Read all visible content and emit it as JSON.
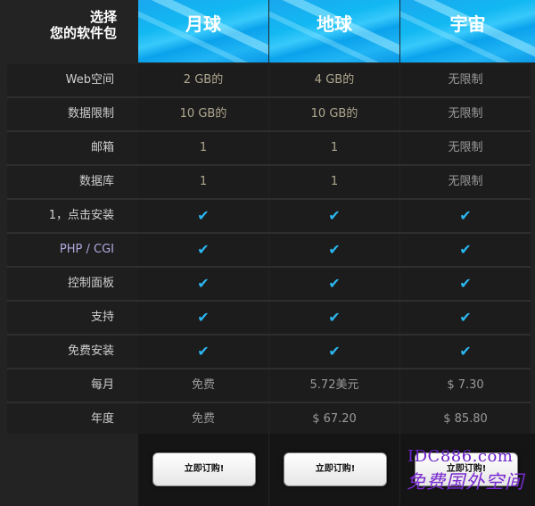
{
  "header": {
    "title_line1": "选择",
    "title_line2": "您的软件包"
  },
  "plans": [
    {
      "name": "月球"
    },
    {
      "name": "地球"
    },
    {
      "name": "宇宙"
    }
  ],
  "features": [
    {
      "label": "Web空间",
      "values": [
        "2 GB的",
        "4 GB的",
        "无限制"
      ]
    },
    {
      "label": "数据限制",
      "values": [
        "10 GB的",
        "10 GB的",
        "无限制"
      ]
    },
    {
      "label": "邮箱",
      "values": [
        "1",
        "1",
        "无限制"
      ]
    },
    {
      "label": "数据库",
      "values": [
        "1",
        "1",
        "无限制"
      ]
    },
    {
      "label": "1，点击安装",
      "values": [
        "✔",
        "✔",
        "✔"
      ]
    },
    {
      "label": "PHP / CGI",
      "values": [
        "✔",
        "✔",
        "✔"
      ]
    },
    {
      "label": "控制面板",
      "values": [
        "✔",
        "✔",
        "✔"
      ]
    },
    {
      "label": "支持",
      "values": [
        "✔",
        "✔",
        "✔"
      ]
    },
    {
      "label": "免费安装",
      "values": [
        "✔",
        "✔",
        "✔"
      ]
    },
    {
      "label": "每月",
      "values": [
        "免费",
        "5.72美元",
        "$ 7.30"
      ]
    },
    {
      "label": "年度",
      "values": [
        "免费",
        "$ 67.20",
        "$ 85.80"
      ]
    }
  ],
  "buttons": {
    "order_label": "立即订购!"
  },
  "watermark": {
    "line1": "IDC886.com",
    "line2": "免费国外空间"
  },
  "icons": {
    "check": "check-icon"
  },
  "colors": {
    "header_blue": "#12b8f2",
    "check": "#2bb7f0",
    "background": "#232323"
  }
}
